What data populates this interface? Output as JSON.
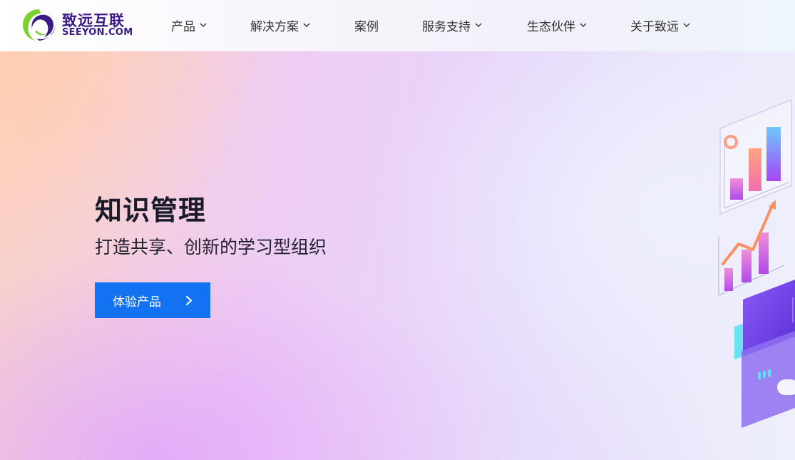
{
  "brand": {
    "name_cn": "致远互联",
    "name_en": "SEEYON.COM",
    "colors": {
      "purple": "#3a1a86",
      "green": "#7cd12e"
    }
  },
  "nav": {
    "items": [
      {
        "label": "产品",
        "has_dropdown": true
      },
      {
        "label": "解决方案",
        "has_dropdown": true
      },
      {
        "label": "案例",
        "has_dropdown": false
      },
      {
        "label": "服务支持",
        "has_dropdown": true
      },
      {
        "label": "生态伙伴",
        "has_dropdown": true
      },
      {
        "label": "关于致远",
        "has_dropdown": true
      }
    ],
    "dropdown_icon": "chevron-down-icon"
  },
  "hero": {
    "title": "知识管理",
    "subtitle": "打造共享、创新的学习型组织",
    "cta_label": "体验产品",
    "cta_icon": "chevron-right-icon",
    "cta_color": "#1272f2"
  }
}
